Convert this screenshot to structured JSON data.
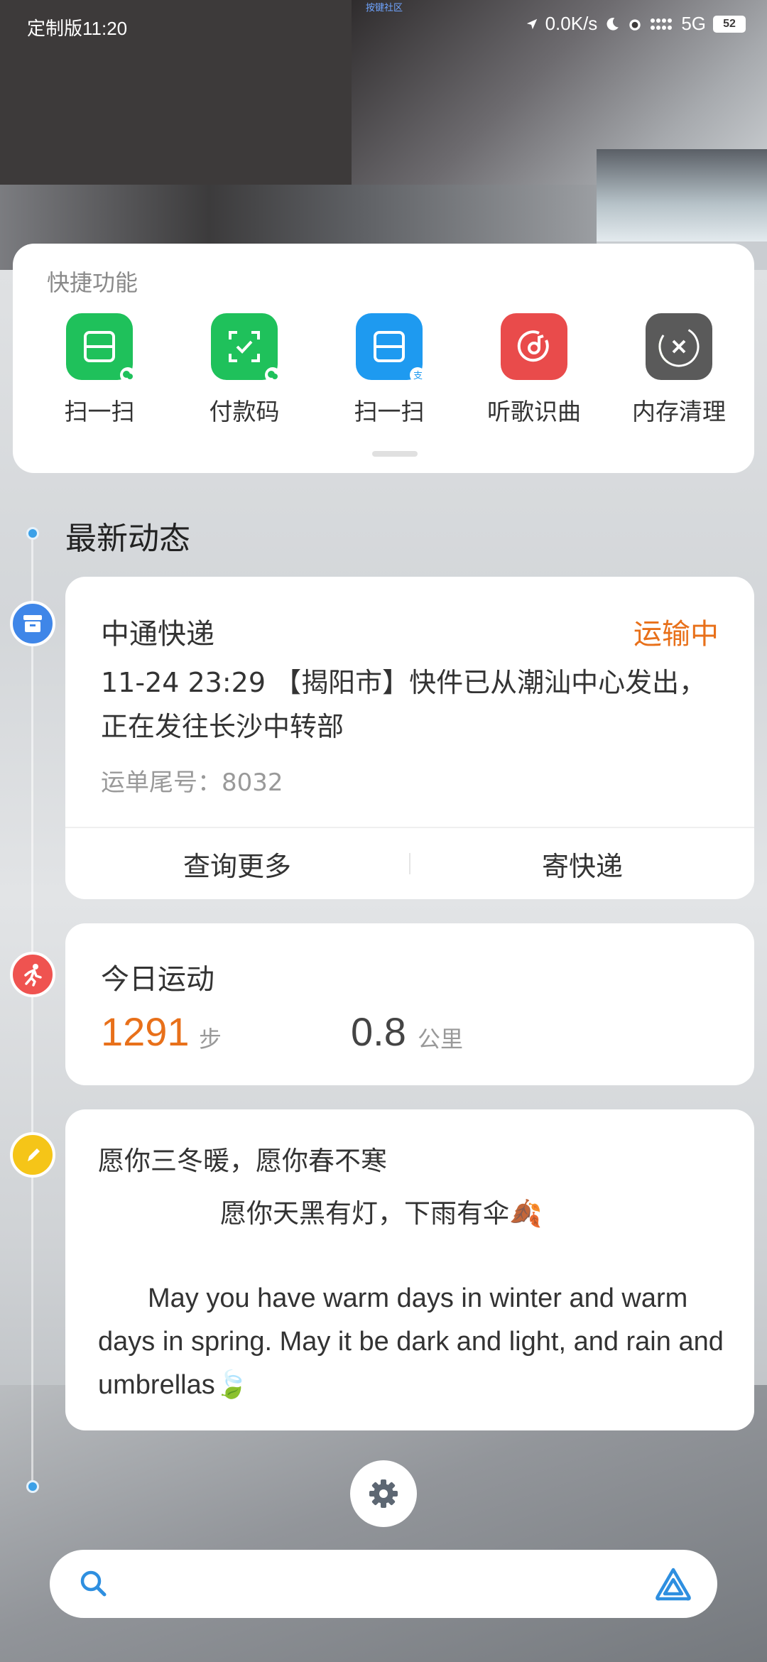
{
  "status_bar": {
    "carrier_time": "定制版11:20",
    "center_text": "按键社区",
    "network_speed": "0.0K/s",
    "signal": "5G",
    "battery": "52"
  },
  "quick": {
    "title": "快捷功能",
    "items": [
      {
        "label": "扫一扫",
        "icon": "wechat-scan-icon",
        "color": "#1fc15b"
      },
      {
        "label": "付款码",
        "icon": "wechat-pay-code-icon",
        "color": "#1fc15b"
      },
      {
        "label": "扫一扫",
        "icon": "alipay-scan-icon",
        "color": "#1e9af0"
      },
      {
        "label": "听歌识曲",
        "icon": "music-recognition-icon",
        "color": "#e94b4b"
      },
      {
        "label": "内存清理",
        "icon": "memory-clean-icon",
        "color": "#5a5a5a"
      }
    ]
  },
  "feed": {
    "title": "最新动态",
    "express": {
      "company": "中通快递",
      "status": "运输中",
      "detail": "11-24 23:29 【揭阳市】快件已从潮汕中心发出，正在发往长沙中转部",
      "tracking": "运单尾号：8032",
      "action_more": "查询更多",
      "action_send": "寄快递"
    },
    "sport": {
      "title": "今日运动",
      "steps": "1291",
      "steps_unit": "步",
      "distance": "0.8",
      "distance_unit": "公里"
    },
    "note": {
      "line1": "愿你三冬暖，愿你春不寒",
      "line2": "愿你天黑有灯，下雨有伞🍂",
      "english": "May you have warm days in winter and warm days in spring. May it be dark and light, and rain and umbrellas🍃"
    }
  },
  "search": {
    "placeholder": ""
  },
  "colors": {
    "accent_orange": "#e8701a",
    "timeline_blue": "#3aa0e8"
  }
}
